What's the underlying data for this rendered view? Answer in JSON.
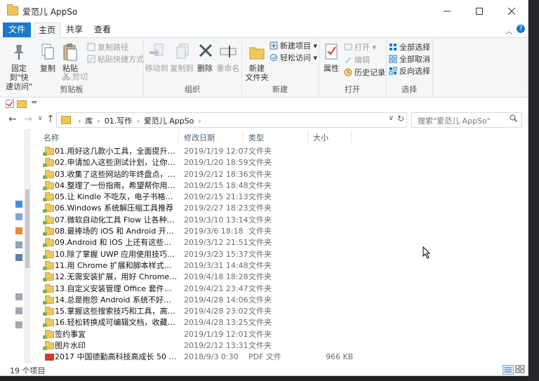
{
  "window": {
    "title": "爱范儿 AppSo"
  },
  "ribbon_tabs": [
    "文件",
    "主页",
    "共享",
    "查看"
  ],
  "ribbon": {
    "clipboard": {
      "pin_line1": "固定到\"快",
      "pin_line2": "速访问\"",
      "copy": "复制",
      "paste": "粘贴",
      "copy_path": "复制路径",
      "paste_shortcut": "粘贴快捷方式",
      "cut": "剪切",
      "label": "剪贴板"
    },
    "organize": {
      "move_to": "移动到",
      "copy_to": "复制到",
      "delete": "删除",
      "rename": "重命名",
      "label": "组织"
    },
    "new": {
      "new_folder_line1": "新建",
      "new_folder_line2": "文件夹",
      "new_item": "新建项目",
      "easy_access": "轻松访问",
      "label": "新建"
    },
    "open": {
      "properties": "属性",
      "open": "打开",
      "edit": "编辑",
      "history": "历史记录",
      "label": "打开"
    },
    "select": {
      "select_all": "全部选择",
      "select_none": "全部取消",
      "invert": "反向选择",
      "label": "选择"
    }
  },
  "qat": {
    "dropdown": "="
  },
  "address": {
    "crumbs": [
      "库",
      "01.写作",
      "爱范儿 AppSo"
    ],
    "search_placeholder": "搜索\"爱范儿 AppSo\""
  },
  "columns": [
    "名称",
    "修改日期",
    "类型",
    "大小"
  ],
  "files": [
    {
      "name": "01.用好这几款小工具，全面提升刷微博...",
      "date": "2019/1/19 12:07",
      "type": "文件夹",
      "size": "",
      "kind": "folder"
    },
    {
      "name": "02.申请加入这些测试计划，让你提前享...",
      "date": "2019/1/20 18:59",
      "type": "文件夹",
      "size": "",
      "kind": "folder"
    },
    {
      "name": "03.收集了这些网站的年终盘点，帮你做...",
      "date": "2019/2/12 18:36",
      "type": "文件夹",
      "size": "",
      "kind": "folder"
    },
    {
      "name": "04.整理了一份指南，希望帮你用实惠价...",
      "date": "2019/2/15 18:48",
      "type": "文件夹",
      "size": "",
      "kind": "folder"
    },
    {
      "name": "05.让 Kindle 不吃灰，电子书格式转换工...",
      "date": "2019/2/15 21:13",
      "type": "文件夹",
      "size": "",
      "kind": "folder"
    },
    {
      "name": "06.Windows 系统解压缩工具推荐",
      "date": "2019/2/27 18:23",
      "type": "文件夹",
      "size": "",
      "kind": "folder"
    },
    {
      "name": "07.微软自动化工具 Flow 让各种工作流...",
      "date": "2019/3/10 13:14",
      "type": "文件夹",
      "size": "",
      "kind": "folder"
    },
    {
      "name": "08.最捧场的 iOS 和 Android 开发者，...",
      "date": "2019/3/6 18:18",
      "type": "文件夹",
      "size": "",
      "kind": "folder"
    },
    {
      "name": "09.Android 和 iOS 上还有这些实用键盘",
      "date": "2019/3/12 21:51",
      "type": "文件夹",
      "size": "",
      "kind": "folder"
    },
    {
      "name": "10.除了掌握 UWP 应用使用技巧，还有...",
      "date": "2019/3/23 15:37",
      "type": "文件夹",
      "size": "",
      "kind": "folder"
    },
    {
      "name": "11.用 Chrome 扩展和脚本样式改进 bili...",
      "date": "2019/3/31 14:48",
      "type": "文件夹",
      "size": "",
      "kind": "folder"
    },
    {
      "name": "12.无需安装扩展，用好 Chrome 自带截...",
      "date": "2019/4/18 18:28",
      "type": "文件夹",
      "size": "",
      "kind": "folder"
    },
    {
      "name": "13.自定义安装管理 Office 套件，一款小...",
      "date": "2019/4/21 23:47",
      "type": "文件夹",
      "size": "",
      "kind": "folder"
    },
    {
      "name": "14.总是抱怨 Android 系统不好用? 尝试...",
      "date": "2019/4/28 14:06",
      "type": "文件夹",
      "size": "",
      "kind": "folder"
    },
    {
      "name": "15.掌握这些搜索技巧和工具，高效省时...",
      "date": "2019/4/28 23:02",
      "type": "文件夹",
      "size": "",
      "kind": "folder"
    },
    {
      "name": "16.轻松转换成可编辑文档，收藏这四款...",
      "date": "2019/4/28 13:25",
      "type": "文件夹",
      "size": "",
      "kind": "folder"
    },
    {
      "name": "签约事宜",
      "date": "2019/1/19 12:01",
      "type": "文件夹",
      "size": "",
      "kind": "folder"
    },
    {
      "name": "图片水印",
      "date": "2019/2/12 13:31",
      "type": "文件夹",
      "size": "",
      "kind": "folder"
    },
    {
      "name": "2017 中国德勤高科技高成长 50 强报告...",
      "date": "2018/9/3 0:30",
      "type": "PDF 文件",
      "size": "966 KB",
      "kind": "pdf"
    }
  ],
  "status": {
    "count": "19 个项目"
  },
  "colors": {
    "accent": "#1979ca",
    "folder": "#eec85e",
    "header_text": "#4c607a"
  }
}
